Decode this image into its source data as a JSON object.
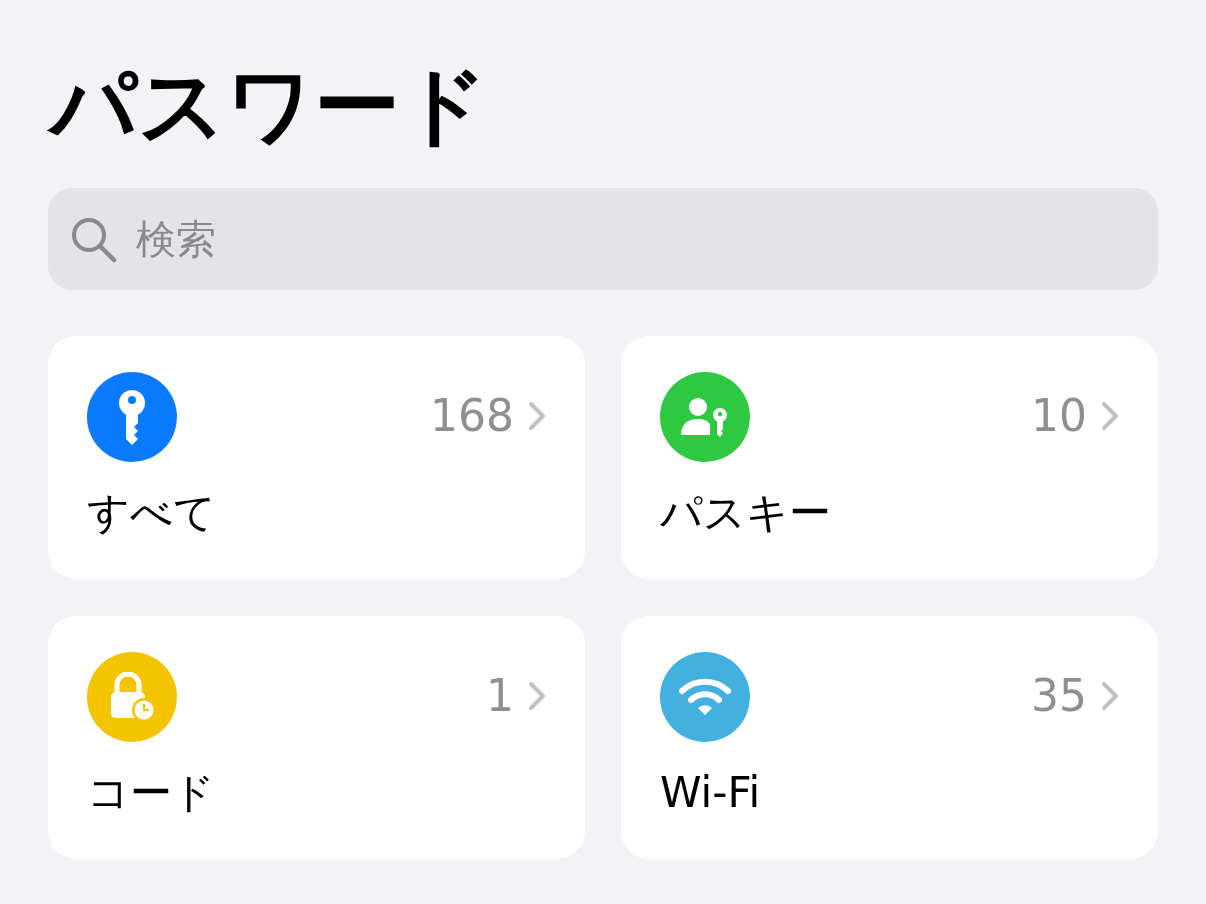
{
  "title": "パスワード",
  "search": {
    "placeholder": "検索"
  },
  "categories": [
    {
      "kind": "key",
      "label": "すべて",
      "count": "168",
      "color": "#0a7aff"
    },
    {
      "kind": "passkey",
      "label": "パスキー",
      "count": "10",
      "color": "#2fc841"
    },
    {
      "kind": "code",
      "label": "コード",
      "count": "1",
      "color": "#f5c400"
    },
    {
      "kind": "wifi",
      "label": "Wi-Fi",
      "count": "35",
      "color": "#43b1e0"
    }
  ]
}
